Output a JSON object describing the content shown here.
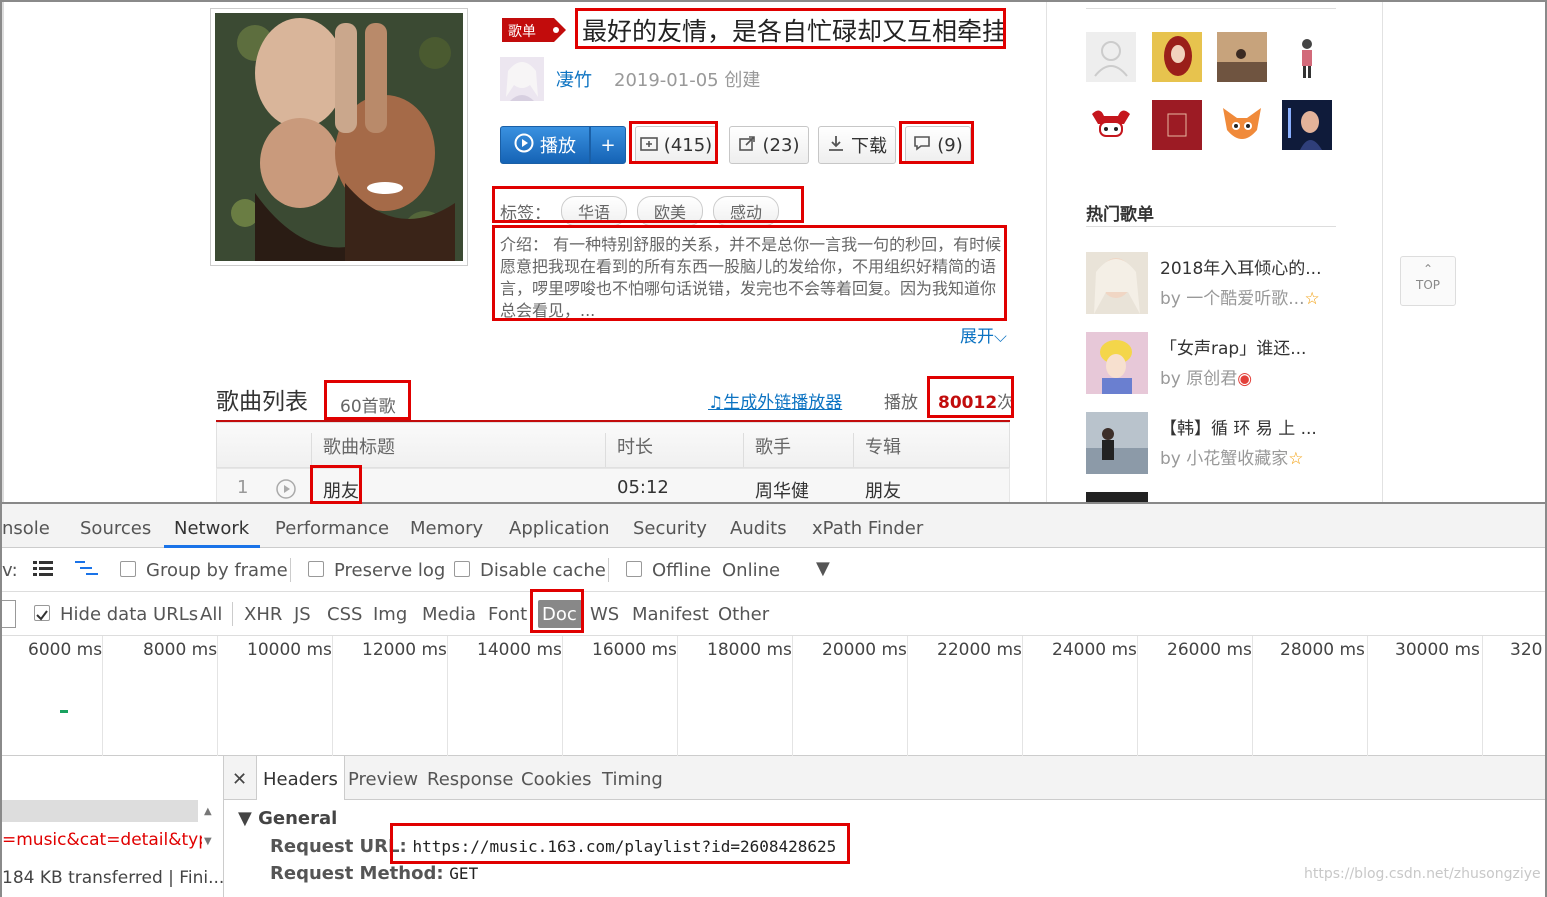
{
  "playlist": {
    "badge": "歌单",
    "title": "最好的友情，是各自忙碌却又互相牵挂",
    "creator": "凄竹",
    "created": "2019-01-05 创建",
    "buttons": {
      "play": "播放",
      "add": "+",
      "favorite": "(415)",
      "share": "(23)",
      "download": "下载",
      "comment": "(9)"
    },
    "tags_label": "标签：",
    "tags": [
      "华语",
      "欧美",
      "感动"
    ],
    "intro": "介绍： 有一种特别舒服的关系，并不是总你一言我一句的秒回，有时候愿意把我现在看到的所有东西一股脑儿的发给你，不用组织好精简的语言，啰里啰唆也不怕哪句话说错，发完也不会等着回复。因为我知道你总会看见，...",
    "expand": "展开"
  },
  "songlist": {
    "heading": "歌曲列表",
    "count": "60首歌",
    "ext_link": "生成外链播放器",
    "play_label": "播放",
    "play_count": "80012",
    "play_unit": "次",
    "columns": [
      "歌曲标题",
      "时长",
      "歌手",
      "专辑"
    ],
    "rows": [
      {
        "index": "1",
        "title": "朋友",
        "duration": "05:12",
        "artist": "周华健",
        "album": "朋友"
      }
    ]
  },
  "sidebar": {
    "hot_label": "热门歌单",
    "hot": [
      {
        "title": "2018年入耳倾心的...",
        "by": "by 一个酷爱听歌..."
      },
      {
        "title": "「女声rap」谁还...",
        "by": "by 原创君"
      },
      {
        "title": "【韩】循 环 易 上 ...",
        "by": "by 小花蟹收藏家"
      }
    ],
    "top_button": "TOP"
  },
  "devtools": {
    "tabs": [
      "nsole",
      "Sources",
      "Network",
      "Performance",
      "Memory",
      "Application",
      "Security",
      "Audits",
      "xPath Finder"
    ],
    "toolbar1": {
      "view_label": "v:",
      "group_by_frame": "Group by frame",
      "preserve_log": "Preserve log",
      "disable_cache": "Disable cache",
      "offline": "Offline",
      "online": "Online"
    },
    "toolbar2": {
      "hide_data_urls": "Hide data URLs",
      "filters": [
        "All",
        "XHR",
        "JS",
        "CSS",
        "Img",
        "Media",
        "Font",
        "Doc",
        "WS",
        "Manifest",
        "Other"
      ]
    },
    "timeline_ticks": [
      "6000 ms",
      "8000 ms",
      "10000 ms",
      "12000 ms",
      "14000 ms",
      "16000 ms",
      "18000 ms",
      "20000 ms",
      "22000 ms",
      "24000 ms",
      "26000 ms",
      "28000 ms",
      "30000 ms",
      "320"
    ],
    "left_pane": {
      "request": "=music&cat=detail&typ",
      "status": "184 KB transferred  |  Fini..."
    },
    "detail_tabs": [
      "Headers",
      "Preview",
      "Response",
      "Cookies",
      "Timing"
    ],
    "general": {
      "heading": "General",
      "request_url_label": "Request URL:",
      "request_url": "https://music.163.com/playlist?id=2608428625",
      "request_method_label": "Request Method:",
      "request_method": "GET"
    }
  },
  "watermark": "https://blog.csdn.net/zhusongziye",
  "colors": {
    "highlight": "#e00000",
    "accent_blue": "#0c73c2",
    "play_red": "#c20c0c"
  }
}
